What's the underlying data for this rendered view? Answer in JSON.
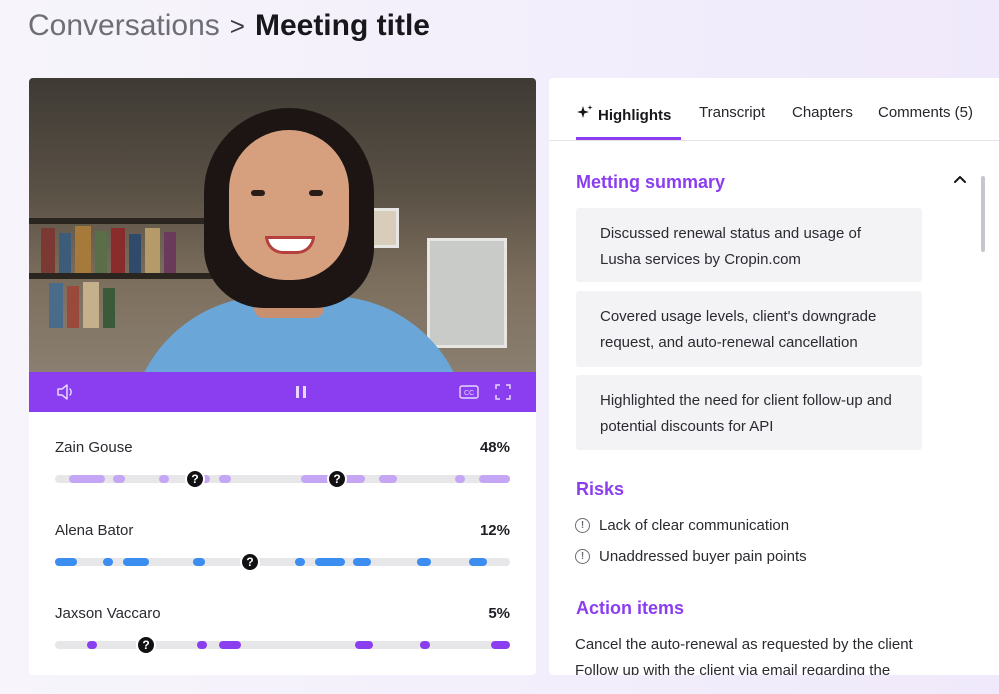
{
  "breadcrumb": {
    "parent": "Conversations",
    "separator": ">",
    "current": "Meeting title"
  },
  "player": {
    "controls": [
      "volume-icon",
      "pause-icon",
      "captions-icon",
      "fullscreen-icon"
    ],
    "cc_label": "CC"
  },
  "speakers": [
    {
      "name": "Zain Gouse",
      "percent": "48%",
      "color": "#c4a6f5",
      "marker": "?"
    },
    {
      "name": "Alena Bator",
      "percent": "12%",
      "color": "#3b8df0",
      "marker": "?"
    },
    {
      "name": "Jaxson Vaccaro",
      "percent": "5%",
      "color": "#8b3ef0",
      "marker": "?"
    }
  ],
  "tabs": [
    {
      "label": "Highlights",
      "active": true
    },
    {
      "label": "Transcript",
      "active": false
    },
    {
      "label": "Chapters",
      "active": false
    },
    {
      "label": "Comments (5)",
      "active": false
    }
  ],
  "summary": {
    "title": "Metting summary",
    "items": [
      "Discussed renewal status and usage of Lusha services by Cropin.com",
      "Covered  usage levels, client's downgrade request, and auto-renewal cancellation",
      "Highlighted the need for client follow-up and potential discounts for API"
    ]
  },
  "risks": {
    "title": "Risks",
    "items": [
      "Lack of clear communication",
      "Unaddressed buyer pain points"
    ]
  },
  "actions": {
    "title": "Action items",
    "items": [
      "Cancel the auto-renewal as requested by the client",
      "Follow up with the client via email regarding the"
    ]
  },
  "colors": {
    "accent": "#8b3ef0",
    "card_bg": "#f3f3f6"
  }
}
